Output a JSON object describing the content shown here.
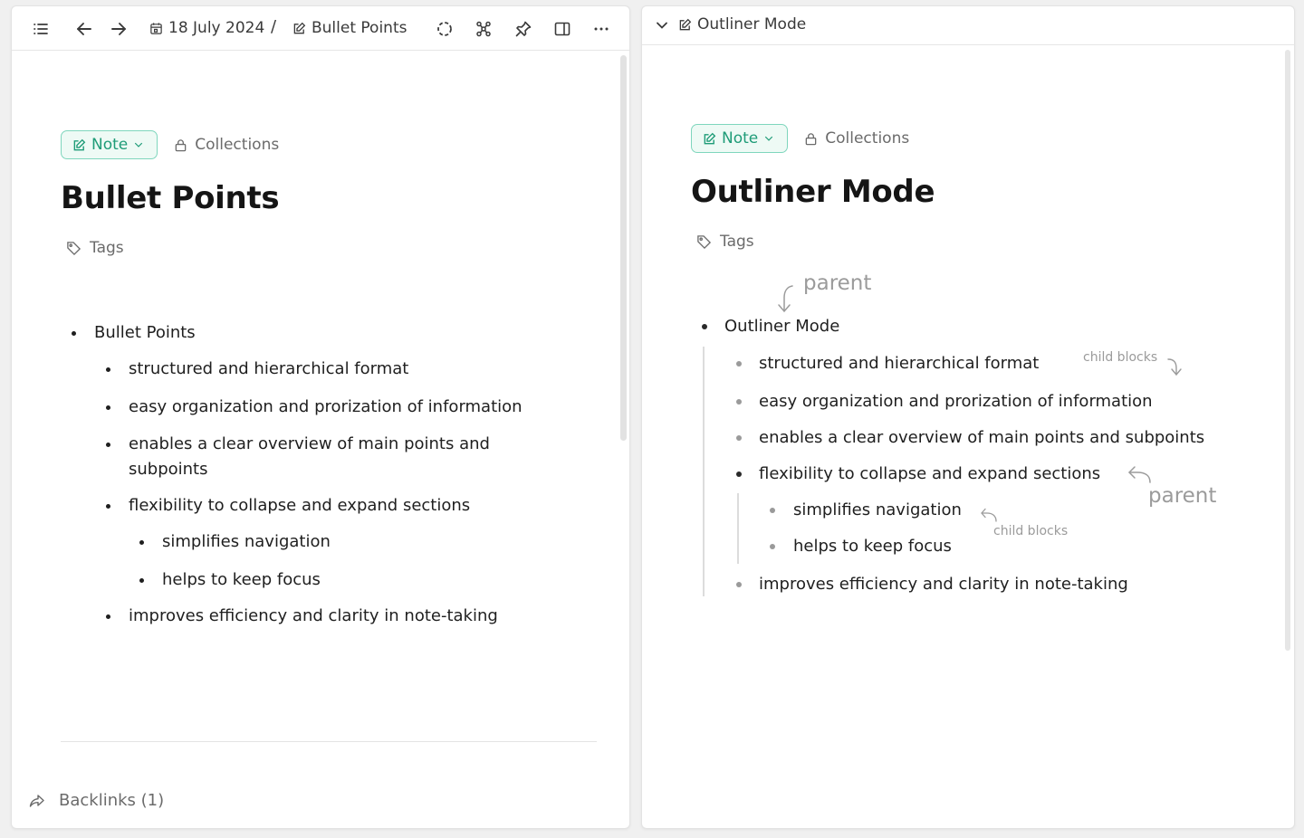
{
  "left_pane": {
    "toolbar": {
      "date": "18 July 2024",
      "separator": "/",
      "page": "Bullet Points"
    },
    "note_type": "Note",
    "collections": "Collections",
    "title": "Bullet Points",
    "tags": "Tags",
    "bullets": {
      "root": "Bullet Points",
      "c1": "structured and hierarchical format",
      "c2": "easy organization and prorization of information",
      "c3": "enables a clear overview of main points and subpoints",
      "c4": "flexibility to collapse and expand sections",
      "g1": "simplifies navigation",
      "g2": "helps to keep focus",
      "c5": "improves efficiency and clarity in note-taking"
    },
    "backlinks": "Backlinks (1)"
  },
  "right_pane": {
    "header": "Outliner Mode",
    "note_type": "Note",
    "collections": "Collections",
    "title": "Outliner Mode",
    "tags": "Tags",
    "bullets": {
      "root": "Outliner Mode",
      "c1": "structured and hierarchical format",
      "c2": "easy organization and prorization of information",
      "c3": "enables a clear overview of main points and subpoints",
      "c4": "flexibility to collapse and expand sections",
      "g1": "simplifies navigation",
      "g2": "helps to keep focus",
      "c5": "improves efficiency and clarity in note-taking"
    },
    "annotations": {
      "parent_top": "parent",
      "child_blocks_top": "child blocks",
      "parent_mid": "parent",
      "child_blocks_mid": "child blocks"
    }
  },
  "colors": {
    "accent": "#1f9c78",
    "accent_border": "#7fd6bd",
    "annotation": "#9b9b9b"
  },
  "icons": [
    "list-icon",
    "arrow-left-icon",
    "arrow-right-icon",
    "calendar-icon",
    "edit-icon",
    "dashed-circle-icon",
    "graph-icon",
    "pin-icon",
    "sidebar-icon",
    "more-icon",
    "chevron-down-icon",
    "lock-icon",
    "tag-icon",
    "share-icon"
  ]
}
